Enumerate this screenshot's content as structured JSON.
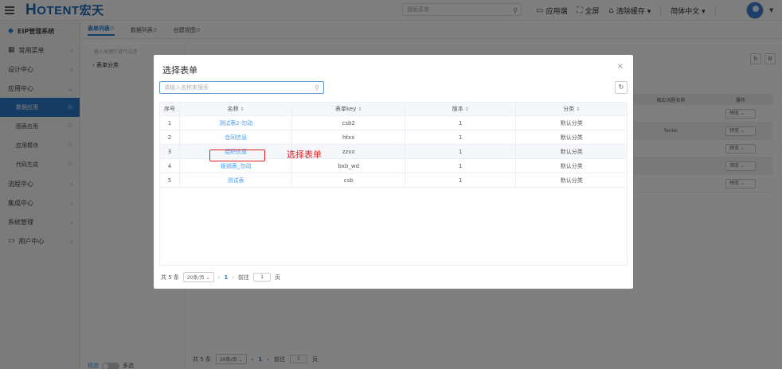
{
  "header": {
    "logo_main": "H",
    "logo_rest": "OTENT宏天",
    "search_placeholder": "搜索菜单",
    "items": [
      {
        "icon": "monitor-icon",
        "glyph": "▭",
        "label": "应用端"
      },
      {
        "icon": "fullscreen-icon",
        "glyph": "⛶",
        "label": "全屏"
      },
      {
        "icon": "clear-cache-icon",
        "glyph": "⌂",
        "label": "清除缓存 ▾"
      },
      {
        "icon": "language-icon",
        "glyph": "",
        "label": "简体中文 ▾"
      }
    ]
  },
  "sidebar": {
    "system_name": "EIP管理系统",
    "items": [
      {
        "label": "常用菜单"
      },
      {
        "label": "设计中心"
      },
      {
        "label": "应用中心"
      },
      {
        "label": "数据应用"
      },
      {
        "label": "图表应用"
      },
      {
        "label": "应用模块"
      },
      {
        "label": "代码生成"
      },
      {
        "label": "流程中心"
      },
      {
        "label": "集成中心"
      },
      {
        "label": "系统管理"
      },
      {
        "label": "用户中心"
      }
    ],
    "bottom_left": "精选",
    "bottom_right": "多选"
  },
  "tabs": [
    "表单列表✩",
    "数据列表✩",
    "创建视图✩"
  ],
  "tree": {
    "search_placeholder": "输入关键字进行过滤",
    "root": "表单分类"
  },
  "bg_table": {
    "head_col1": "相应流程名称",
    "head_col2": "操作",
    "rows": [
      {
        "name": "",
        "op": "预览"
      },
      {
        "name": "fenlei",
        "op": "预览"
      },
      {
        "name": "",
        "op": "预览"
      },
      {
        "name": "",
        "op": "预览"
      },
      {
        "name": "",
        "op": "预览"
      }
    ]
  },
  "bg_pager": {
    "total": "共 5 条",
    "size": "20条/页",
    "page": "1",
    "goto_label": "前往",
    "goto_value": "1",
    "page_unit": "页"
  },
  "modal": {
    "title": "选择表单",
    "close": "×",
    "search_placeholder": "请输入名称来搜索",
    "columns": {
      "no": "序号",
      "name": "名称",
      "key": "表单key",
      "version": "版本",
      "category": "分类"
    },
    "rows": [
      {
        "no": "1",
        "name": "测试表2-勿动",
        "key": "csb2",
        "version": "1",
        "category": "默认分类"
      },
      {
        "no": "2",
        "name": "合同信息",
        "key": "htxx",
        "version": "1",
        "category": "默认分类"
      },
      {
        "no": "3",
        "name": "组织信息",
        "key": "zzxx",
        "version": "1",
        "category": "默认分类"
      },
      {
        "no": "4",
        "name": "报销表_勿动",
        "key": "bxb_wd",
        "version": "1",
        "category": "默认分类"
      },
      {
        "no": "5",
        "name": "测试表",
        "key": "csb",
        "version": "1",
        "category": "默认分类"
      }
    ],
    "annotation": "选择表单",
    "pager": {
      "total": "共 5 条",
      "size": "20条/页",
      "page": "1",
      "goto_label": "前往",
      "goto_value": "1",
      "page_unit": "页"
    }
  }
}
